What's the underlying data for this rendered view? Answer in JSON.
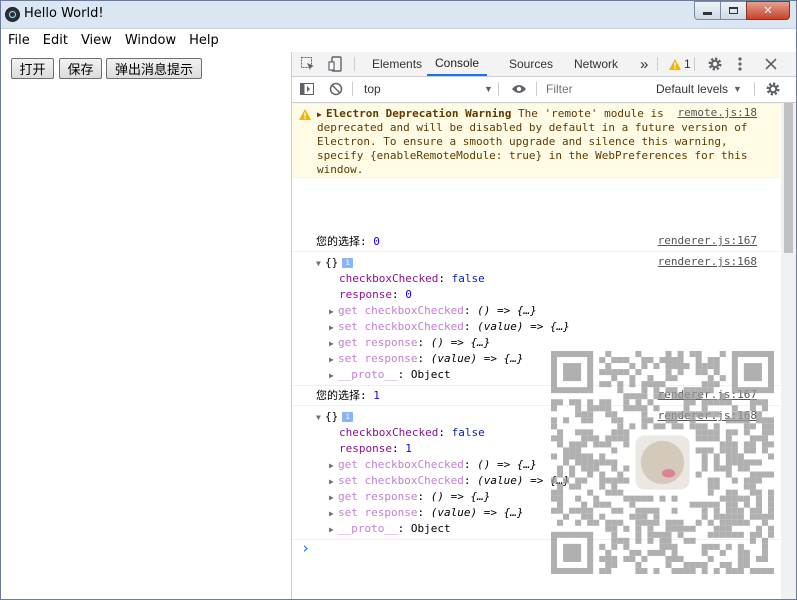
{
  "window": {
    "title": "Hello World!"
  },
  "menu": [
    "File",
    "Edit",
    "View",
    "Window",
    "Help"
  ],
  "buttons": {
    "open": "打开",
    "save": "保存",
    "popup": "弹出消息提示"
  },
  "devtools": {
    "tabs": [
      "Elements",
      "Console",
      "Sources",
      "Network"
    ],
    "more_tabs": "»",
    "warning_count": "1",
    "context": "top",
    "filter_placeholder": "Filter",
    "levels": "Default levels"
  },
  "console": {
    "warning": {
      "title": "Electron Deprecation Warning",
      "line1": " The 'remote' module is",
      "line2": "deprecated and will be disabled by default in a future version of",
      "line3": "Electron. To ensure a smooth upgrade and silence this warning,",
      "line4": "specify {enableRemoteModule: true} in the WebPreferences for this",
      "line5": "window.",
      "source": "remote.js:18"
    },
    "entries": [
      {
        "choice_label": "您的选择: ",
        "choice_value": "0",
        "src1": "renderer.js:167",
        "obj": "{}",
        "src2": "renderer.js:168",
        "p1k": "checkboxChecked",
        "p1v": "false",
        "p2k": "response",
        "p2v": "0",
        "g1": "get checkboxChecked",
        "g1v": "() => {…}",
        "s1": "set checkboxChecked",
        "s1v": "(value) => {…}",
        "g2": "get response",
        "g2v": "() => {…}",
        "s2": "set response",
        "s2v": "(value) => {…}",
        "proto": "__proto__",
        "protov": "Object"
      },
      {
        "choice_label": "您的选择: ",
        "choice_value": "1",
        "src1": "renderer.js:167",
        "obj": "{}",
        "src2": "renderer.js:168",
        "p1k": "checkboxChecked",
        "p1v": "false",
        "p2k": "response",
        "p2v": "1",
        "g1": "get checkboxChecked",
        "g1v": "() => {…}",
        "s1": "set checkboxChecked",
        "s1v": "(value) => {…}",
        "g2": "get response",
        "g2v": "() => {…}",
        "s2": "set response",
        "s2v": "(value) => {…}",
        "proto": "__proto__",
        "protov": "Object"
      }
    ],
    "prompt": "›"
  },
  "colors": {
    "accent": "#1a73e8",
    "warning_bg": "#fffbe5",
    "warning_icon": "#f5b400"
  },
  "icons": [
    "inspect-icon",
    "device-toolbar-icon",
    "warning-icon",
    "settings-gear-icon",
    "kebab-menu-icon",
    "close-icon",
    "sidebar-toggle-icon",
    "clear-console-icon",
    "eye-icon",
    "qr-code-overlay"
  ]
}
